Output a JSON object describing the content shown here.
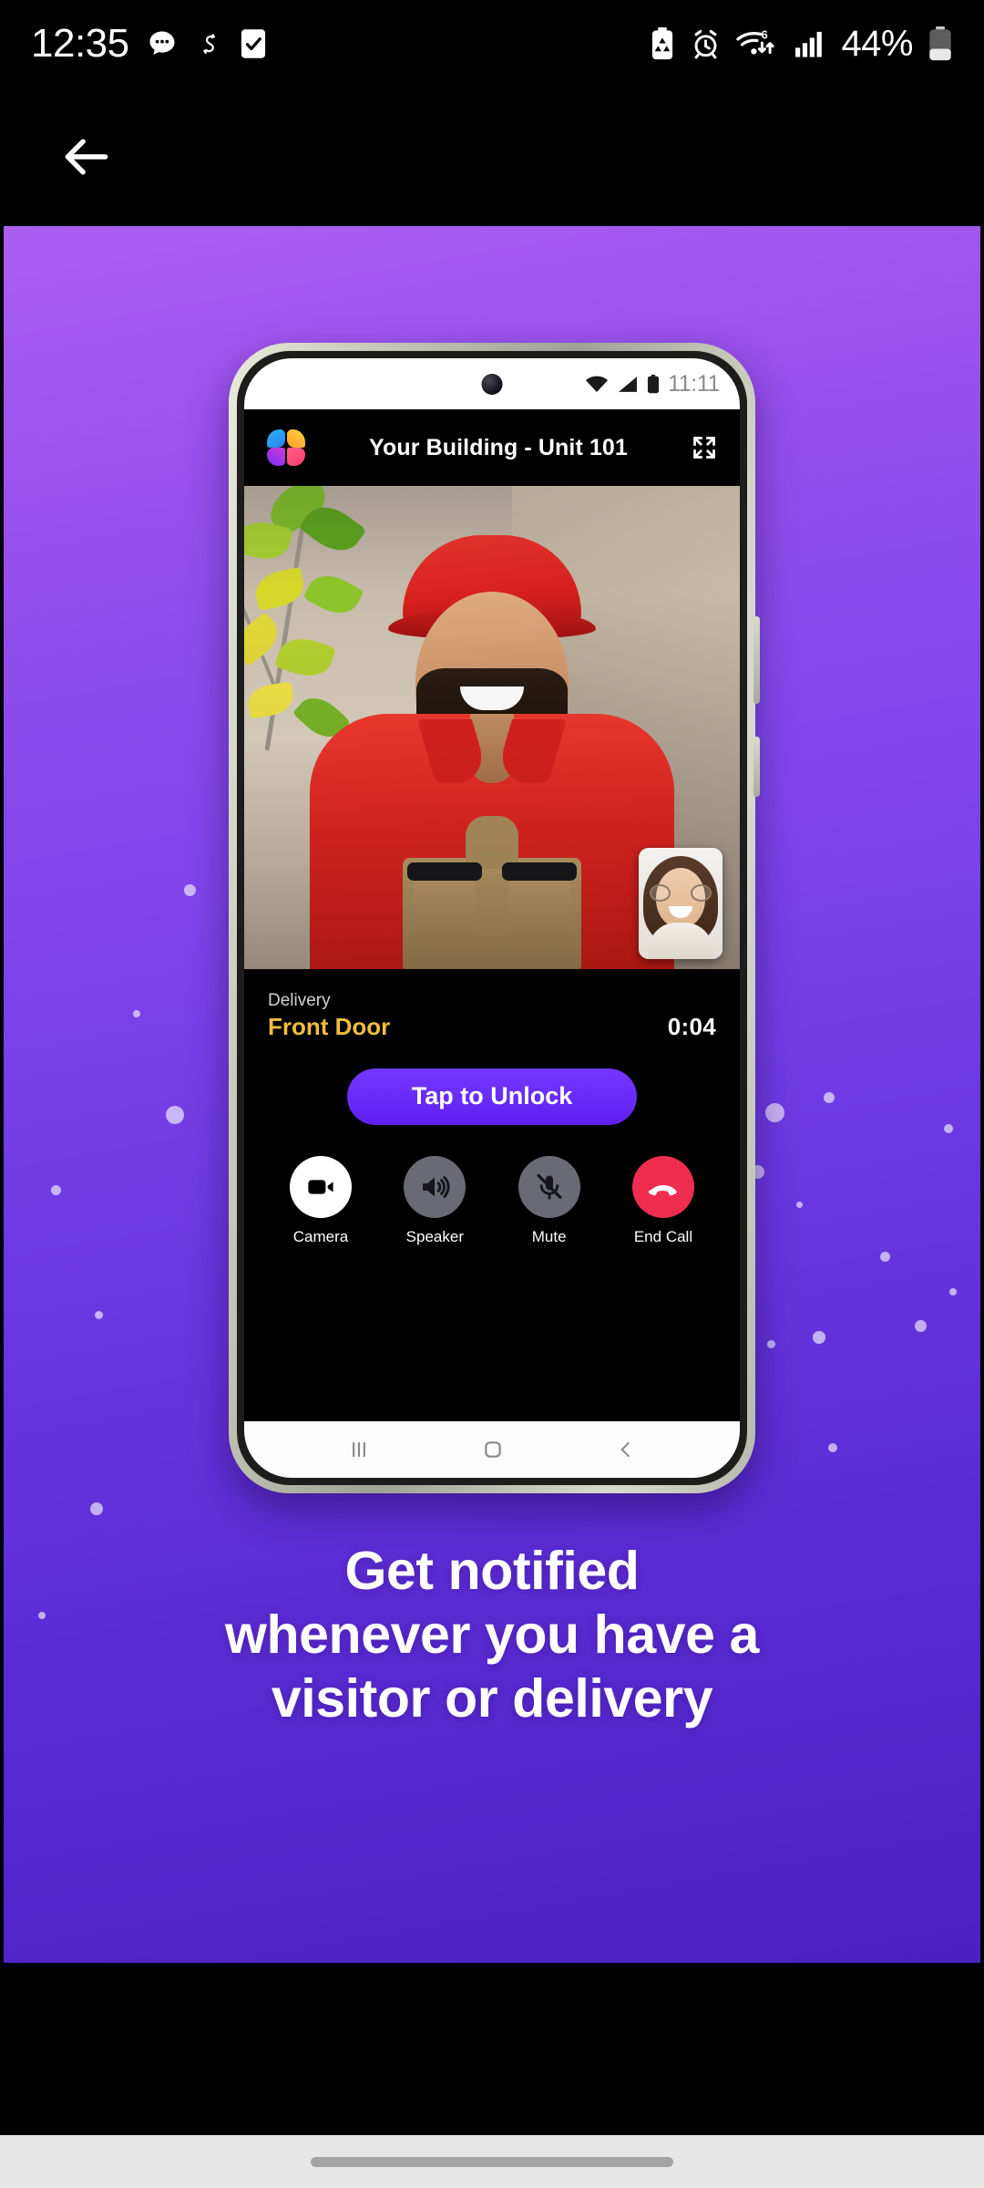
{
  "os_status_bar": {
    "clock": "12:35",
    "battery_percent": "44%",
    "left_icons": [
      "message-bubble-icon",
      "refresh-sync-icon",
      "checkbox-checked-icon"
    ],
    "right_icons": [
      "battery-saver-icon",
      "alarm-icon",
      "wifi-6-icon",
      "cellular-signal-icon",
      "battery-icon"
    ]
  },
  "app_bar": {
    "back_label": "back-arrow"
  },
  "promo": {
    "headline_lines": [
      "Get notified",
      "whenever you have a",
      "visitor or delivery"
    ],
    "background_top_color": "#ab5ef0",
    "background_bottom_color": "#4a22c4"
  },
  "device": {
    "status_bar": {
      "time": "11:11"
    },
    "app_header": {
      "title": "Your Building - Unit 101",
      "logo": "butterfly-logo",
      "expand_icon": "fullscreen-expand-icon"
    },
    "call": {
      "visitor_type": "Delivery",
      "location": "Front Door",
      "timer": "0:04",
      "unlock_label": "Tap to Unlock",
      "unlock_color": "#6a29f5",
      "location_color": "#f1bd3e",
      "controls": [
        {
          "label": "Camera",
          "icon": "video-camera-icon",
          "state": "active",
          "color": "#ffffff"
        },
        {
          "label": "Speaker",
          "icon": "speaker-icon",
          "state": "inactive",
          "color": "#6a6a74"
        },
        {
          "label": "Mute",
          "icon": "mic-muted-icon",
          "state": "inactive",
          "color": "#6a6a74"
        },
        {
          "label": "End Call",
          "icon": "phone-hangup-icon",
          "state": "danger",
          "color": "#ef2d50"
        }
      ]
    },
    "nav_bar": {
      "recents": "recents-icon",
      "home": "home-icon",
      "back": "back-icon"
    }
  }
}
